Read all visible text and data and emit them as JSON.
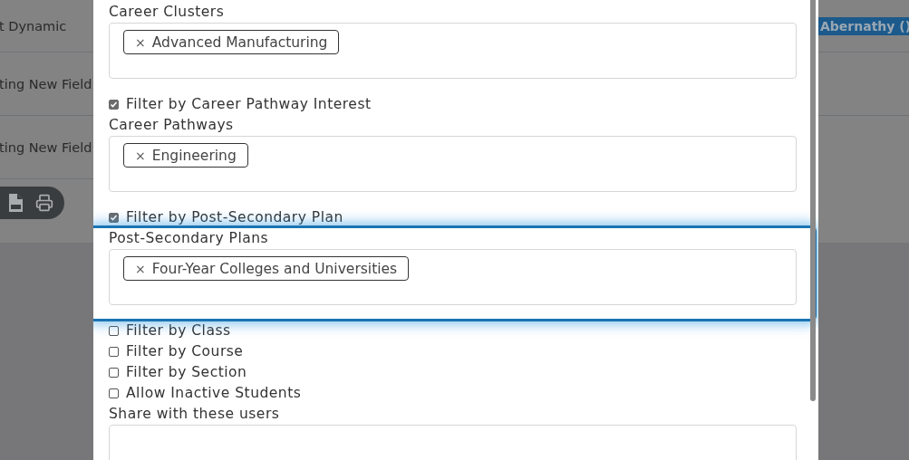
{
  "background": {
    "rows": [
      {
        "text": "t Dynamic"
      },
      {
        "text": "ting New Field"
      },
      {
        "text": "ting New Field"
      }
    ],
    "badge": "Abernathy ()"
  },
  "modal": {
    "items": [
      {
        "kind": "field",
        "label": "Career Clusters",
        "highlighted": false,
        "tags": [
          {
            "remove": "×",
            "text": "Advanced Manufacturing"
          }
        ]
      },
      {
        "kind": "checkbox",
        "label": "Filter by Career Pathway Interest",
        "checked": true
      },
      {
        "kind": "field",
        "label": "Career Pathways",
        "highlighted": false,
        "tags": [
          {
            "remove": "×",
            "text": "Engineering"
          }
        ]
      },
      {
        "kind": "checkbox",
        "label": "Filter by Post-Secondary Plan",
        "checked": true
      },
      {
        "kind": "field",
        "label": "Post-Secondary Plans",
        "highlighted": true,
        "tags": [
          {
            "remove": "×",
            "text": "Four-Year Colleges and Universities"
          }
        ]
      },
      {
        "kind": "checkbox",
        "label": "Filter by Class",
        "checked": false
      },
      {
        "kind": "checkbox",
        "label": "Filter by Course",
        "checked": false
      },
      {
        "kind": "checkbox",
        "label": "Filter by Section",
        "checked": false
      },
      {
        "kind": "checkbox",
        "label": "Allow Inactive Students",
        "checked": false
      },
      {
        "kind": "field",
        "label": "Share with these users",
        "highlighted": false
      }
    ]
  }
}
